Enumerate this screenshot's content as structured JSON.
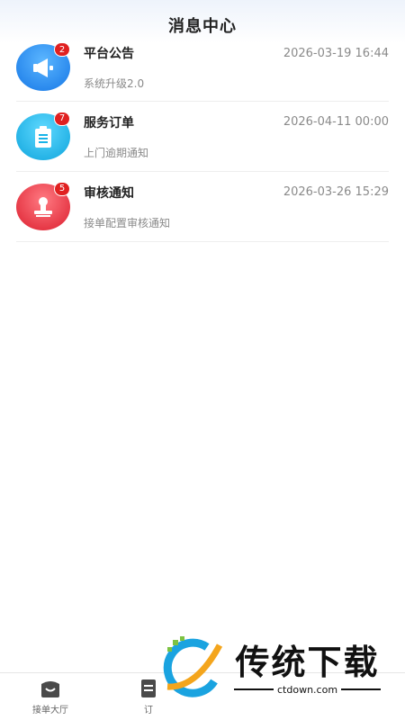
{
  "header": {
    "title": "消息中心"
  },
  "messages": [
    {
      "name": "平台公告",
      "time": "2026-03-19 16:44",
      "subtitle": "系统升级2.0",
      "badge": "2",
      "icon": "megaphone-icon",
      "color": "#1e90ff"
    },
    {
      "name": "服务订单",
      "time": "2026-04-11 00:00",
      "subtitle": "上门逾期通知",
      "badge": "7",
      "icon": "clipboard-icon",
      "color": "#18b3e8"
    },
    {
      "name": "审核通知",
      "time": "2026-03-26 15:29",
      "subtitle": "接单配置审核通知",
      "badge": "5",
      "icon": "stamp-icon",
      "color": "#e8303c"
    }
  ],
  "tabbar": {
    "items": [
      {
        "label": "接单大厅",
        "icon": "hall-icon"
      },
      {
        "label": "订",
        "icon": "order-icon"
      }
    ]
  },
  "watermark": {
    "title": "传统下载",
    "url": "ctdown.com"
  }
}
